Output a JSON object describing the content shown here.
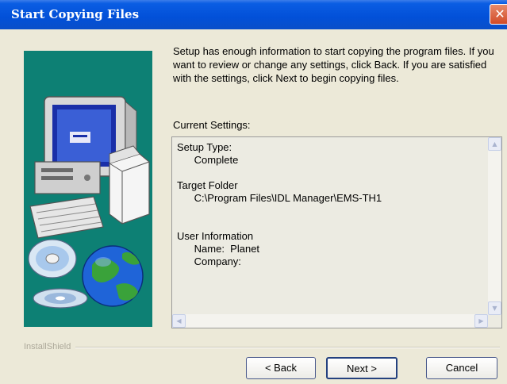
{
  "window": {
    "title": "Start Copying Files",
    "close_glyph": "✕"
  },
  "intro_text": "Setup has enough information to start copying the program files. If you want to review or change any settings, click Back.  If you are satisfied with the settings, click Next to begin copying files.",
  "current_settings_label": "Current Settings:",
  "settings_text": "Setup Type:\n      Complete\n\nTarget Folder\n      C:\\Program Files\\IDL Manager\\EMS-TH1\n\n\nUser Information\n      Name:  Planet\n      Company:",
  "brand": "InstallShield",
  "buttons": {
    "back": "< Back",
    "next": "Next >",
    "cancel": "Cancel"
  },
  "icons": [
    "computer-illustration",
    "cd-disc-icon",
    "globe-icon",
    "close-icon",
    "scroll-up-arrow",
    "scroll-down-arrow",
    "scroll-left-arrow",
    "scroll-right-arrow"
  ],
  "colors": {
    "title_bar": "#0a5de3",
    "art_bg": "#0d8074",
    "dialog_bg": "#ece9d8"
  }
}
